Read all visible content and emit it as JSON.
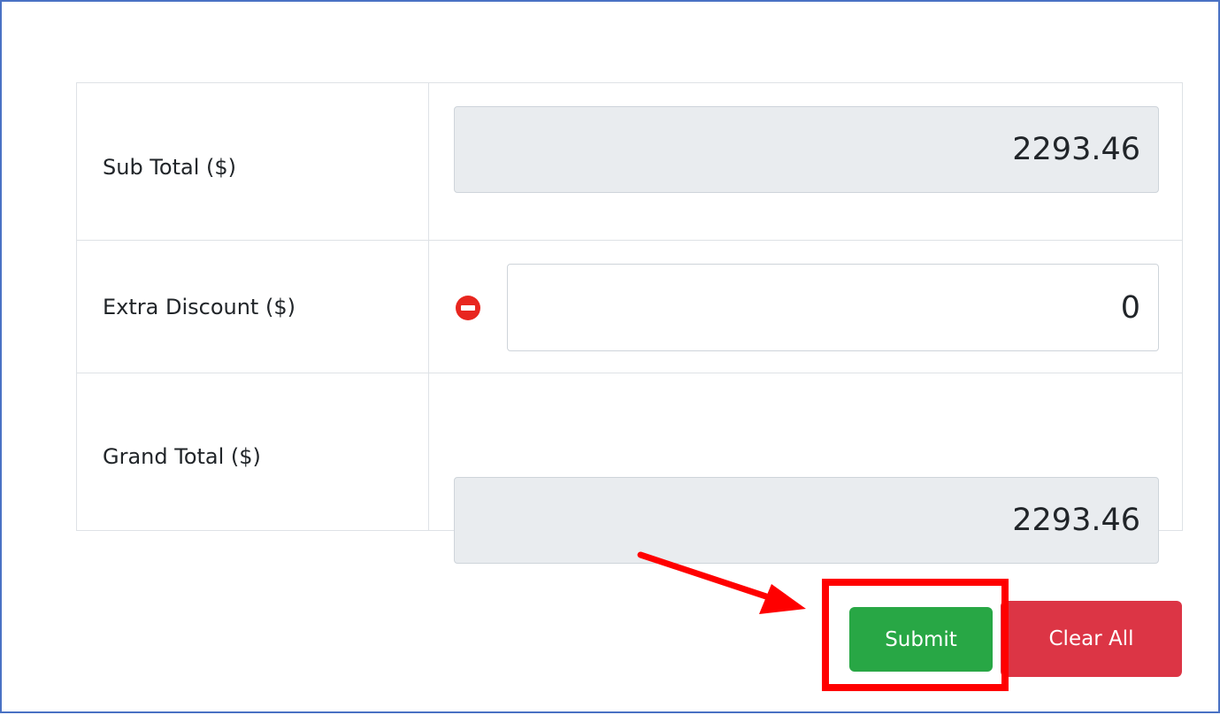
{
  "totals": {
    "sub_total": {
      "label": "Sub Total ($)",
      "value": "2293.46"
    },
    "extra_discount": {
      "label": "Extra Discount ($)",
      "value": "0",
      "icon": "minus-circle-icon"
    },
    "grand_total": {
      "label": "Grand Total ($)",
      "value": "2293.46"
    }
  },
  "actions": {
    "submit_label": "Submit",
    "clear_label": "Clear All"
  },
  "colors": {
    "frame_border": "#4a72c4",
    "submit": "#28a745",
    "clear": "#dc3545",
    "highlight": "#ff0000",
    "minus_icon": "#e8261f"
  }
}
